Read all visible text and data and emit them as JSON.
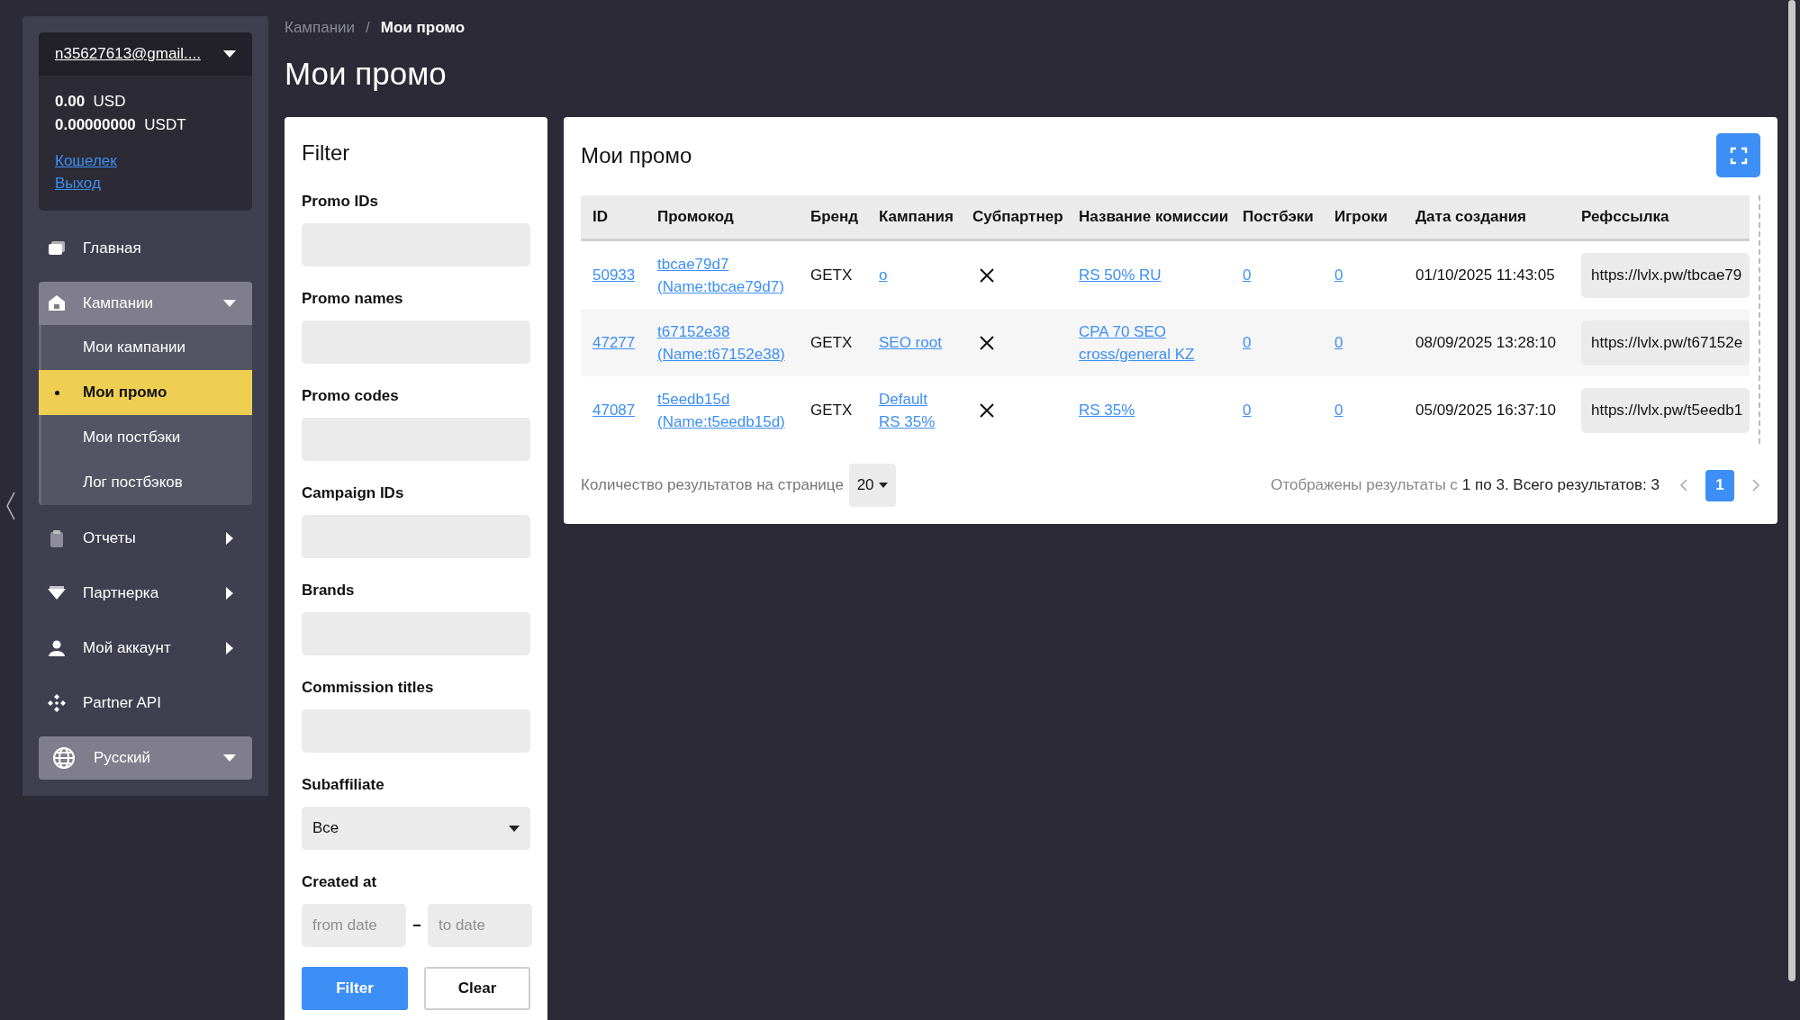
{
  "sidebar": {
    "account": {
      "email": "n35627613@gmail....",
      "balances": [
        {
          "amount": "0.00",
          "currency": "USD"
        },
        {
          "amount": "0.00000000",
          "currency": "USDT"
        }
      ],
      "links": [
        "Кошелек",
        "Выход"
      ]
    },
    "items": [
      {
        "label": "Главная",
        "kind": "link"
      },
      {
        "label": "Кампании",
        "kind": "group",
        "expanded": true,
        "children": [
          {
            "label": "Мои кампании",
            "selected": false
          },
          {
            "label": "Мои промо",
            "selected": true
          },
          {
            "label": "Мои постбэки",
            "selected": false
          },
          {
            "label": "Лог постбэков",
            "selected": false
          }
        ]
      },
      {
        "label": "Отчеты",
        "kind": "group",
        "expanded": false
      },
      {
        "label": "Партнерка",
        "kind": "group",
        "expanded": false
      },
      {
        "label": "Мой аккаунт",
        "kind": "group",
        "expanded": false
      },
      {
        "label": "Partner API",
        "kind": "link"
      }
    ],
    "language": {
      "label": "Русский"
    }
  },
  "breadcrumb_separator": "/",
  "breadcrumb": [
    {
      "label": "Кампании",
      "current": false
    },
    {
      "label": "Мои промо",
      "current": true
    }
  ],
  "page_title": "Мои промо",
  "filter": {
    "title": "Filter",
    "fields": [
      {
        "label": "Promo IDs",
        "kind": "text"
      },
      {
        "label": "Promo names",
        "kind": "text"
      },
      {
        "label": "Promo codes",
        "kind": "text"
      },
      {
        "label": "Campaign IDs",
        "kind": "text"
      },
      {
        "label": "Brands",
        "kind": "text"
      },
      {
        "label": "Commission titles",
        "kind": "text"
      },
      {
        "label": "Subaffiliate",
        "kind": "select",
        "value": "Все"
      },
      {
        "label": "Created at",
        "kind": "daterange",
        "placeholders": [
          "from date",
          "to date"
        ]
      }
    ],
    "buttons": [
      {
        "label": "Filter",
        "kind": "primary"
      },
      {
        "label": "Clear",
        "kind": "secondary"
      }
    ]
  },
  "table": {
    "title": "Мои промо",
    "columns": [
      "ID",
      "Промокод",
      "Бренд",
      "Кампания",
      "Субпартнер",
      "Название комиссии",
      "Постбэки",
      "Игроки",
      "Дата создания",
      "Рефссылка"
    ],
    "rows": [
      {
        "id": "50933",
        "promo_code": "tbcae79d7",
        "promo_name": "(Name:tbcae79d7)",
        "brand": "GETX",
        "campaign": "o",
        "subpartner": false,
        "commission": "RS 50% RU",
        "postbacks": "0",
        "players": "0",
        "created": "01/10/2025 11:43:05",
        "ref_link": "https://lvlx.pw/tbcae79"
      },
      {
        "id": "47277",
        "promo_code": "t67152e38",
        "promo_name": "(Name:t67152e38)",
        "brand": "GETX",
        "campaign": "SEO root",
        "subpartner": false,
        "commission": "CPA 70 SEO cross/general KZ",
        "postbacks": "0",
        "players": "0",
        "created": "08/09/2025 13:28:10",
        "ref_link": "https://lvlx.pw/t67152e"
      },
      {
        "id": "47087",
        "promo_code": "t5eedb15d",
        "promo_name": "(Name:t5eedb15d)",
        "brand": "GETX",
        "campaign": "Default RS 35%",
        "subpartner": false,
        "commission": "RS 35%",
        "postbacks": "0",
        "players": "0",
        "created": "05/09/2025 16:37:10",
        "ref_link": "https://lvlx.pw/t5eedb1"
      }
    ],
    "per_page_label": "Количество результатов на странице",
    "per_page": "20",
    "summary_prefix": "Отображены результаты с",
    "summary_range": "1 по 3. Всего результатов: 3",
    "pages": [
      {
        "label": "1",
        "selected": true
      }
    ]
  }
}
